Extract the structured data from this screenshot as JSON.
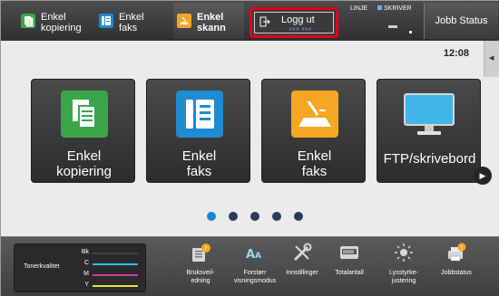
{
  "topbar": {
    "quick": [
      {
        "label_line1": "Enkel",
        "label_line2": "kopiering",
        "icon": "copy-icon",
        "color": "#3aa64a"
      },
      {
        "label_line1": "Enkel",
        "label_line2": "faks",
        "icon": "fax-icon",
        "color": "#1e8bd2"
      },
      {
        "label_line1": "Enkel",
        "label_line2": "skann",
        "icon": "scan-icon",
        "color": "#f5a623"
      }
    ],
    "logout": {
      "label": "Logg ut",
      "sub": "### ###"
    },
    "status_linje": "LINJE",
    "status_skriver": "SKRIVER",
    "jobbstatus": "Jobb Status"
  },
  "main": {
    "clock": "12:08",
    "tiles": [
      {
        "line1": "Enkel",
        "line2": "kopiering",
        "icon": "copy-icon",
        "color": "#3aa64a"
      },
      {
        "line1": "Enkel",
        "line2": "faks",
        "icon": "fax-icon",
        "color": "#1e8bd2"
      },
      {
        "line1": "Enkel",
        "line2": "faks",
        "icon": "scan-icon",
        "color": "#f5a623"
      },
      {
        "line1": "FTP/skrivebord",
        "line2": "",
        "icon": "monitor-icon",
        "color": "#41b6e6"
      }
    ],
    "page_count": 5,
    "active_page": 1
  },
  "bottombar": {
    "toner": {
      "label": "Tonerkvalitet",
      "rows": [
        {
          "name": "Bk",
          "color": "#000000"
        },
        {
          "name": "C",
          "color": "#2ec0e8"
        },
        {
          "name": "M",
          "color": "#d43b9e"
        },
        {
          "name": "Y",
          "color": "#e9e23a"
        }
      ]
    },
    "shortcuts": [
      {
        "line1": "Bruksveil-",
        "line2": "edning",
        "icon": "help-book-icon"
      },
      {
        "line1": "Forstørr",
        "line2": "visningsmodus",
        "icon": "magnify-text-icon"
      },
      {
        "line1": "Innstillinger",
        "line2": "",
        "icon": "tools-icon"
      },
      {
        "line1": "Totalantall",
        "line2": "",
        "icon": "counter-icon"
      },
      {
        "line1": "Lysstyrke-",
        "line2": "justering",
        "icon": "brightness-icon"
      },
      {
        "line1": "Jobbstatus",
        "line2": "",
        "icon": "printer-status-icon"
      }
    ]
  }
}
